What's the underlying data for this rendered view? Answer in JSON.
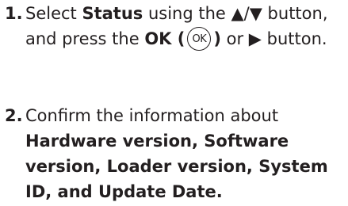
{
  "steps": [
    {
      "number": "1.",
      "part1": "Select ",
      "bold1": "Status",
      "part2": " using the ▲/▼ button, and press the ",
      "bold2": "OK (",
      "ok_glyph": "OK",
      "bold3": ")",
      "part3": " or ▶ button."
    },
    {
      "number": "2.",
      "part1": "Confirm the information about ",
      "bold1": "Hardware version, Software version, Loader version, System ID, and Update Date."
    }
  ],
  "icons": {
    "ok_button": "ok-button-icon"
  }
}
